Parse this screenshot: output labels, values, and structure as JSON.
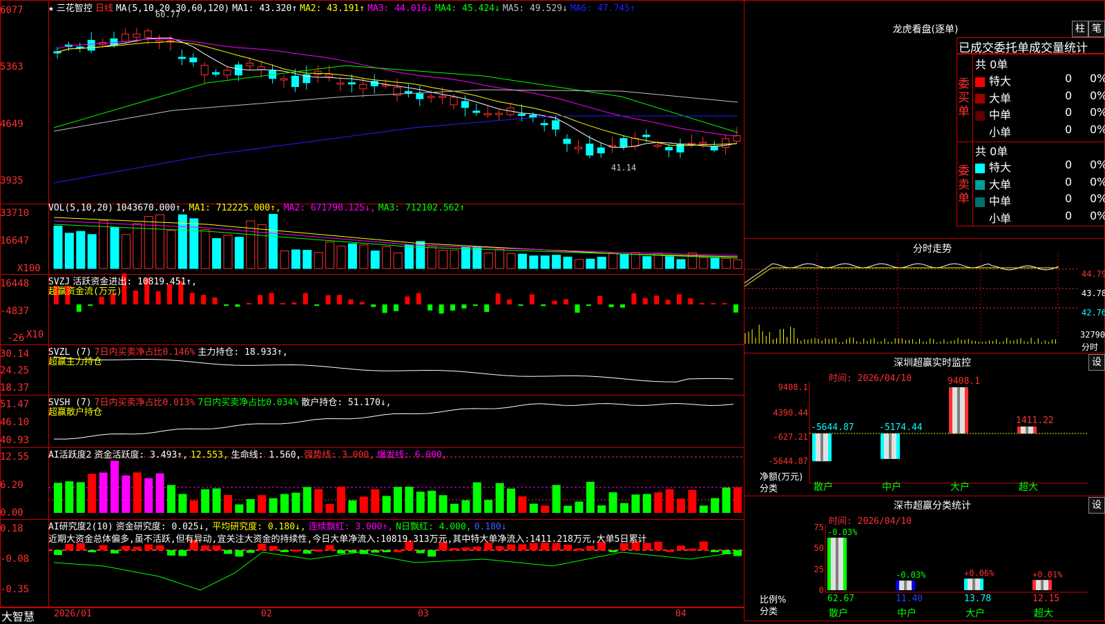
{
  "kline": {
    "star": "★",
    "title": "三花智控",
    "period": "日线",
    "ma_label": "MA(5,10,20,30,60,120)",
    "ma_values": [
      {
        "text": "MA1: 43.320↑",
        "color": "#ffffff"
      },
      {
        "text": "MA2: 43.191↑",
        "color": "#ffff00"
      },
      {
        "text": "MA3: 44.016↓",
        "color": "#ff00ff"
      },
      {
        "text": "MA4: 45.424↓",
        "color": "#00ff00"
      },
      {
        "text": "MA5: 49.529↓",
        "color": "#c0c0c0"
      },
      {
        "text": "MA6: 47.745↑",
        "color": "#2020ff"
      }
    ],
    "y_labels": [
      "6077",
      "5363",
      "4649",
      "3935"
    ],
    "high_mark": "60.77",
    "low_mark": "41.14"
  },
  "vol": {
    "label": "VOL(5,10,20)",
    "values": [
      {
        "text": "1043670.000↑,",
        "color": "#ffffff"
      },
      {
        "text": "MA1: 712225.000↑,",
        "color": "#ffff00"
      },
      {
        "text": "MA2: 671790.125↓,",
        "color": "#ff00ff"
      },
      {
        "text": "MA3: 712102.562↑",
        "color": "#00ff00"
      }
    ],
    "y_labels": [
      "33710",
      "16647"
    ],
    "unit": "X100"
  },
  "svzj": {
    "label": "SVZJ",
    "text": "活跃资金进出: 10819.451↑,",
    "sub": "超赢资金流(万元)",
    "y_labels": [
      "16448",
      "-4837",
      "-26"
    ],
    "unit": "X10"
  },
  "svzl": {
    "label": "SVZL (7)",
    "red": "7日内买卖净占比0.146%",
    "white": "主力持仓: 18.933↑,",
    "sub": "超赢主力持仓",
    "y_labels": [
      "30.14",
      "24.25",
      "18.37"
    ]
  },
  "svsh": {
    "label": "SVSH (7)",
    "red": "7日内买卖净占比0.013%",
    "green": "7日内买卖净占比0.034%",
    "white": "散户持仓: 51.170↓,",
    "sub": "超赢散户持仓",
    "y_labels": [
      "51.47",
      "46.10",
      "40.93"
    ]
  },
  "ai1": {
    "label": "AI活跃度2",
    "w1": "资金活跃度: 3.493↑,",
    "y1": "12.553,",
    "w2": "生命线: 1.560,",
    "r1": "强势线: 3.000,",
    "m1": "爆发线: 6.000,",
    "y_labels": [
      "12.55",
      "6.20",
      "0.00"
    ]
  },
  "ai2": {
    "label": "AI研究度2(10)",
    "w1": "资金研究度: 0.025↓,",
    "y1": "平均研究度: 0.180↓,",
    "m1": "连续飘红: 3.000↑,",
    "g1": "N日飘红: 4.000,",
    "b1": "0.180↓",
    "comment": "近期大资金总体偏多,虽不活跃,但有异动,宜关注大资金的持续性,今日大单净流入:10819.313万元,其中特大单净流入:1411.218万元,大单5日累计",
    "y_labels": [
      "0.18",
      "-0.08",
      "-0.35"
    ]
  },
  "xaxis": {
    "brand": "大智慧",
    "months": [
      "2026/01",
      "02",
      "03",
      "04"
    ]
  },
  "dragon": {
    "title": "龙虎看盘(逐单)",
    "btn1": "柱",
    "btn2": "笔",
    "tabs": "已成交委托单成交量统计",
    "buy_label": "委买单",
    "sell_label": "委卖单",
    "buy_total": "共 0单",
    "sell_total": "共 0单",
    "buy_rows": [
      {
        "name": "特大",
        "n": "0",
        "pct": "0%",
        "color": "#ff0000"
      },
      {
        "name": "大单",
        "n": "0",
        "pct": "0%",
        "color": "#a00000"
      },
      {
        "name": "中单",
        "n": "0",
        "pct": "0%",
        "color": "#600000"
      },
      {
        "name": "小单",
        "n": "0",
        "pct": "0%",
        "color": ""
      }
    ],
    "sell_rows": [
      {
        "name": "特大",
        "n": "0",
        "pct": "0%",
        "color": "#00ffff"
      },
      {
        "name": "大单",
        "n": "0",
        "pct": "0%",
        "color": "#00a0a0"
      },
      {
        "name": "中单",
        "n": "0",
        "pct": "0%",
        "color": "#007070"
      },
      {
        "name": "小单",
        "n": "0",
        "pct": "0%",
        "color": ""
      }
    ]
  },
  "intraday": {
    "title": "分时走势",
    "y_labels": [
      "44.79",
      "43.78",
      "42.76"
    ],
    "vol_label": "32790",
    "vol_unit": "分时"
  },
  "sz_monitor": {
    "title": "深圳超赢实时监控",
    "btn": "设",
    "date": "时间: 2026/04/10",
    "y_labels": [
      "9408.1",
      "4390.44",
      "-627.21",
      "-5644.87"
    ],
    "axis_title": "净额(万元)",
    "axis_sub": "分类",
    "categories": [
      "散户",
      "中户",
      "大户",
      "超大"
    ],
    "values": [
      -5644.87,
      -5174.44,
      9408.1,
      1411.22
    ],
    "value_labels": [
      "-5644.87",
      "-5174.44",
      "9408.1",
      "1411.22"
    ]
  },
  "sz_class": {
    "title": "深市超赢分类统计",
    "btn": "设",
    "date": "时间: 2026/04/10",
    "y_labels": [
      "75",
      "50",
      "25",
      "0"
    ],
    "axis_title": "比例%",
    "axis_sub": "分类",
    "categories": [
      "散户",
      "中户",
      "大户",
      "超大"
    ],
    "values": [
      62.67,
      11.4,
      13.78,
      12.15
    ],
    "bottom_labels": [
      "62.67",
      "11.40",
      "13.78",
      "12.15"
    ],
    "top_labels": [
      "-0.03%",
      "-0.03%",
      "+0.06%",
      "+0.01%"
    ]
  },
  "colors": {
    "frame": "#c00000",
    "up": "#ff3030",
    "down": "#00ffff",
    "green": "#00ff00"
  }
}
